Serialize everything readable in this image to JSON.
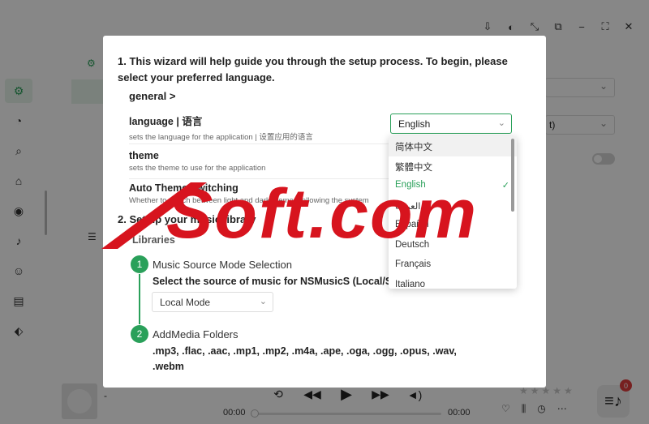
{
  "wizard": {
    "intro": "1. This wizard will help guide you through the setup process. To begin, please select your preferred language.",
    "general_header": "general >",
    "language": {
      "title": "language | 语言",
      "desc": "sets the language for the application | 设置应用的语言",
      "value": "English"
    },
    "theme": {
      "title": "theme",
      "desc": "sets the theme to use for the application"
    },
    "auto_theme": {
      "title": "Auto Theme Switching",
      "desc": "Whether to switch between light and dark themes following the system"
    },
    "section2": {
      "title": "2. Set up your music library",
      "subtitle": "Libraries"
    },
    "step1": {
      "number": "1",
      "title": "Music Source Mode Selection",
      "desc": "Select the source of music for NSMusicS (Local/Server)",
      "mode_value": "Local Mode"
    },
    "step2": {
      "number": "2",
      "title": "AddMedia Folders",
      "desc": ".mp3, .flac, .aac, .mp1, .mp2, .m4a, .ape, .oga, .ogg, .opus, .wav, .webm"
    }
  },
  "language_dropdown": {
    "options": [
      {
        "label": "简体中文",
        "state": "hover"
      },
      {
        "label": "繁體中文",
        "state": ""
      },
      {
        "label": "English",
        "state": "selected"
      },
      {
        "label": "العربية",
        "state": ""
      },
      {
        "label": "Español",
        "state": ""
      },
      {
        "label": "Deutsch",
        "state": ""
      },
      {
        "label": "Français",
        "state": ""
      },
      {
        "label": "Italiano",
        "state": ""
      }
    ]
  },
  "background": {
    "select_value": "t)"
  },
  "player": {
    "track": "-",
    "time_current": "00:00",
    "time_total": "00:00",
    "queue_count": "0"
  },
  "watermark": {
    "text": "Soft.com"
  },
  "colors": {
    "accent": "#2aa05a",
    "watermark_red": "#d7141e",
    "badge": "#e03e3e"
  }
}
